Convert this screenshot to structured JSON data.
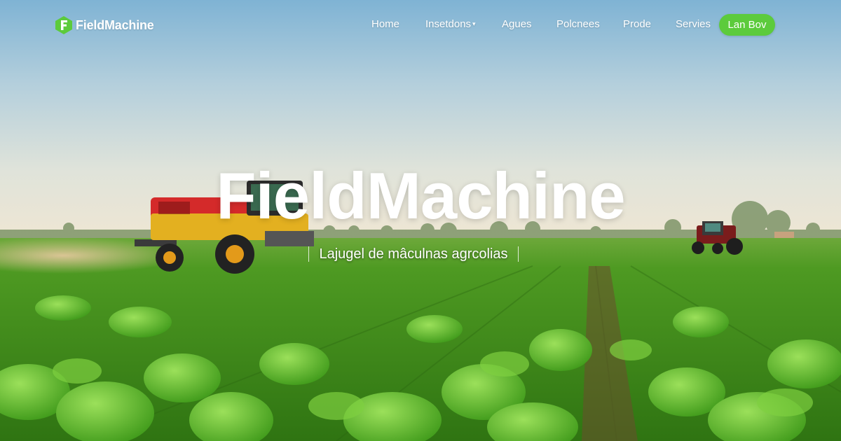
{
  "brand": {
    "name": "FieldMachine",
    "accent_color": "#5ccb3c",
    "logo_icon": "hexagon-f-logo-icon"
  },
  "nav": {
    "items": [
      {
        "label": "Home"
      },
      {
        "label": "Insetdons",
        "has_dropdown": true
      },
      {
        "label": "Agues"
      },
      {
        "label": "Polcnees"
      },
      {
        "label": "Prode"
      },
      {
        "label": "Servies"
      }
    ],
    "cta_label": "Lan Bov"
  },
  "hero": {
    "title": "FieldMachine",
    "subtitle": "Lajugel de mâculnas agrcolias"
  }
}
